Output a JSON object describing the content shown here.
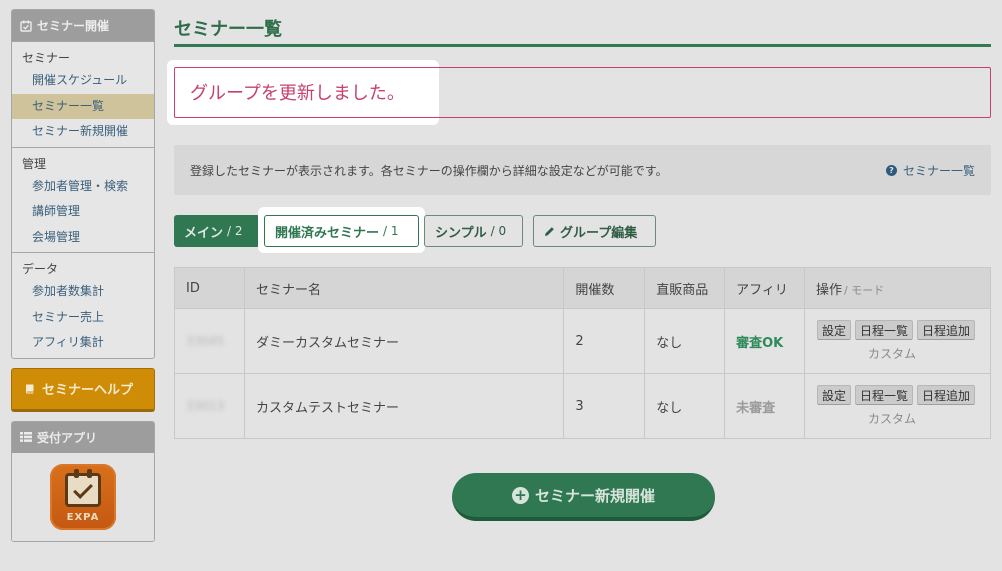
{
  "sidebar": {
    "header": "セミナー開催",
    "groups": [
      {
        "title": "セミナー",
        "items": [
          "開催スケジュール",
          "セミナー一覧",
          "セミナー新規開催"
        ]
      },
      {
        "title": "管理",
        "items": [
          "参加者管理・検索",
          "講師管理",
          "会場管理"
        ]
      },
      {
        "title": "データ",
        "items": [
          "参加者数集計",
          "セミナー売上",
          "アフィリ集計"
        ]
      }
    ],
    "active_item": "セミナー一覧",
    "help_button": "セミナーヘルプ",
    "app_panel": {
      "header": "受付アプリ",
      "logo_text": "EXPA"
    }
  },
  "page": {
    "title": "セミナー一覧",
    "alert": "グループを更新しました。",
    "info_text": "登録したセミナーが表示されます。各セミナーの操作欄から詳細な設定などが可能です。",
    "info_link": "セミナー一覧"
  },
  "tabs": [
    {
      "label": "メイン",
      "count": "/ 2"
    },
    {
      "label": "開催済みセミナー",
      "count": "/ 1"
    },
    {
      "label": "シンプル",
      "count": "/ 0"
    },
    {
      "label": "グループ編集",
      "count": ""
    }
  ],
  "table": {
    "headers": {
      "id": "ID",
      "name": "セミナー名",
      "times": "開催数",
      "product": "直販商品",
      "affiliate": "アフィリ",
      "ops": "操作",
      "mode": "/ モード"
    },
    "rows": [
      {
        "id": "33045",
        "name": "ダミーカスタムセミナー",
        "times": "2",
        "product": "なし",
        "affiliate": "審査OK",
        "mode": "カスタム"
      },
      {
        "id": "33013",
        "name": "カスタムテストセミナー",
        "times": "3",
        "product": "なし",
        "affiliate": "未審査",
        "mode": "カスタム"
      }
    ],
    "op_buttons": [
      "設定",
      "日程一覧",
      "日程追加"
    ]
  },
  "new_button": "セミナー新規開催",
  "colors": {
    "accent_green": "#2f7852",
    "alert_pink": "#c6416f",
    "help_orange": "#cf8c06"
  },
  "icons": [
    "calendar-check-icon",
    "book-icon",
    "grid-icon",
    "question-circle-icon",
    "pencil-icon",
    "plus-circle-icon"
  ]
}
